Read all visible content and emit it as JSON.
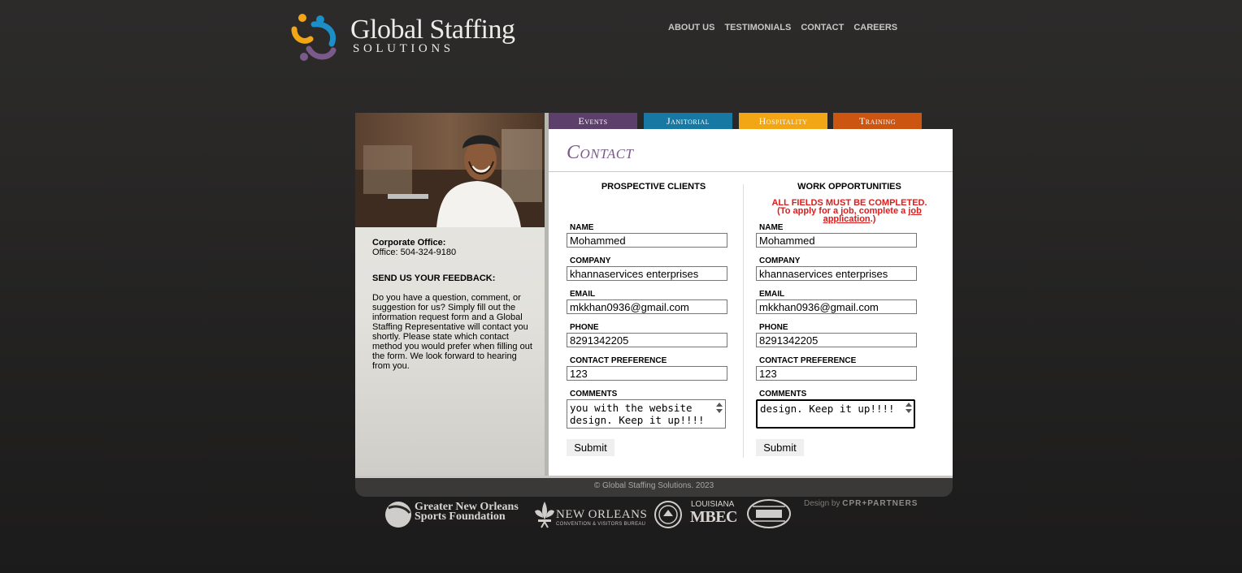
{
  "header": {
    "logo_title": "Global Staffing",
    "logo_subtitle": "SOLUTIONS",
    "nav": [
      "ABOUT US",
      "TESTIMONIALS",
      "CONTACT",
      "CAREERS"
    ]
  },
  "tabs": [
    "Events",
    "Janitorial",
    "Hospitality",
    "Training"
  ],
  "colors": {
    "events": "#5c3f6a",
    "janitorial": "#1779a3",
    "hospitality": "#f2a515",
    "training": "#cc5611",
    "title": "#7a5a8a",
    "notice": "#d81e1e"
  },
  "sidebar": {
    "corp_label": "Corporate Office:",
    "office_phone": "Office: 504-324-9180",
    "feedback_heading": "SEND US YOUR FEEDBACK:",
    "feedback_text": "Do you have a question, comment, or suggestion for us? Simply fill out the information request form and a Global Staffing Representative will contact you shortly. Please state which contact method you would prefer when filling out the form. We look forward to hearing from you."
  },
  "page_title": "Contact",
  "clients_form": {
    "heading": "PROSPECTIVE CLIENTS",
    "name_label": "NAME",
    "name_value": "Mohammed",
    "company_label": "COMPANY",
    "company_value": "khannaservices enterprises",
    "email_label": "EMAIL",
    "email_value": "mkkhan0936@gmail.com",
    "phone_label": "PHONE",
    "phone_value": "8291342205",
    "pref_label": "CONTACT PREFERENCE",
    "pref_value": "123",
    "comments_label": "COMMENTS",
    "comments_value": "you with the website design. Keep it up!!!!",
    "submit_label": "Submit"
  },
  "work_form": {
    "heading": "WORK OPPORTUNITIES",
    "notice_line1": "ALL FIELDS MUST BE COMPLETED.",
    "notice_line2_pre": "(To apply for a job, complete a ",
    "notice_link": "job application",
    "notice_line2_post": ".)",
    "name_label": "NAME",
    "name_value": "Mohammed",
    "company_label": "COMPANY",
    "company_value": "khannaservices enterprises",
    "email_label": "EMAIL",
    "email_value": "mkkhan0936@gmail.com",
    "phone_label": "PHONE",
    "phone_value": "8291342205",
    "pref_label": "CONTACT PREFERENCE",
    "pref_value": "123",
    "comments_label": "COMMENTS",
    "comments_value": "design. Keep it up!!!!",
    "submit_label": "Submit"
  },
  "footer": {
    "copyright": "© Global Staffing Solutions. 2023",
    "partner1_line1": "Greater New Orleans",
    "partner1_line2": "Sports Foundation",
    "partner2_title": "NEW ORLEANS",
    "partner2_sub": "CONVENTION & VISITORS BUREAU",
    "partner4_top": "LOUISIANA",
    "partner4_mark": "MBEC",
    "credit_pre": "Design by ",
    "credit_name": "CPR+PARTNERS"
  }
}
